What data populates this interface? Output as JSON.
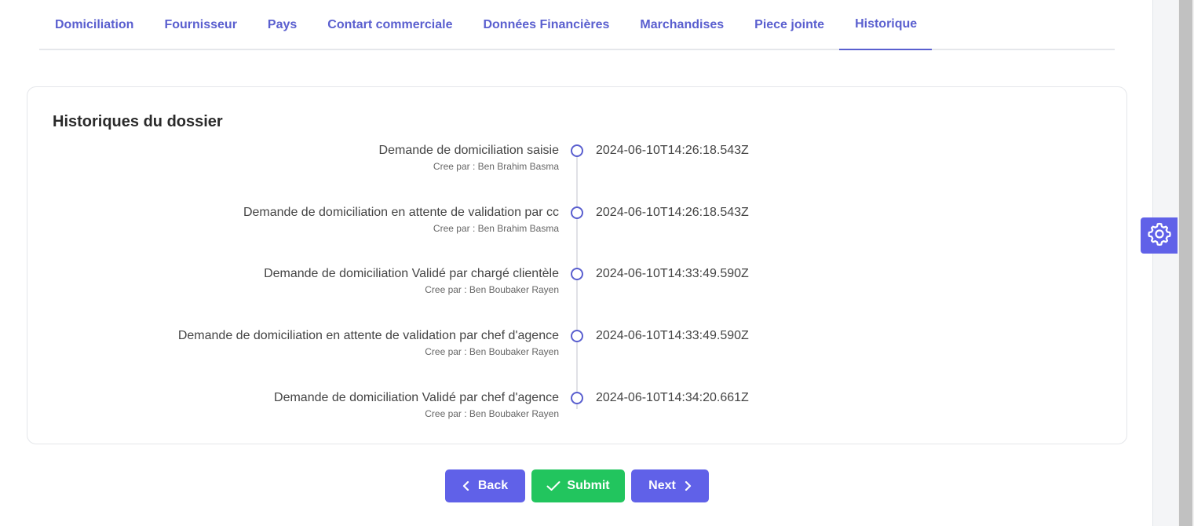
{
  "tabs": [
    {
      "label": "Domiciliation",
      "active": false
    },
    {
      "label": "Fournisseur",
      "active": false
    },
    {
      "label": "Pays",
      "active": false
    },
    {
      "label": "Contart commerciale",
      "active": false
    },
    {
      "label": "Données Financières",
      "active": false
    },
    {
      "label": "Marchandises",
      "active": false
    },
    {
      "label": "Piece jointe",
      "active": false
    },
    {
      "label": "Historique",
      "active": true
    }
  ],
  "history": {
    "title": "Historiques du dossier",
    "events": [
      {
        "title": "Demande de domiciliation saisie",
        "created_by": "Cree par : Ben Brahim Basma",
        "date": "2024-06-10T14:26:18.543Z"
      },
      {
        "title": "Demande de domiciliation en attente de validation par cc",
        "created_by": "Cree par : Ben Brahim Basma",
        "date": "2024-06-10T14:26:18.543Z"
      },
      {
        "title": "Demande de domiciliation Validé par chargé clientèle",
        "created_by": "Cree par : Ben Boubaker Rayen",
        "date": "2024-06-10T14:33:49.590Z"
      },
      {
        "title": "Demande de domiciliation en attente de validation par chef d'agence",
        "created_by": "Cree par : Ben Boubaker Rayen",
        "date": "2024-06-10T14:33:49.590Z"
      },
      {
        "title": "Demande de domiciliation Validé par chef d'agence",
        "created_by": "Cree par : Ben Boubaker Rayen",
        "date": "2024-06-10T14:34:20.661Z"
      }
    ]
  },
  "actions": {
    "back_label": "Back",
    "submit_label": "Submit",
    "next_label": "Next"
  },
  "icons": {
    "back": "chevron-left-icon",
    "submit": "check-icon",
    "next": "chevron-right-icon",
    "settings": "gear-icon"
  },
  "colors": {
    "accent": "#5a5fcf",
    "primary_button": "#6061e8",
    "success_button": "#22c55e"
  }
}
